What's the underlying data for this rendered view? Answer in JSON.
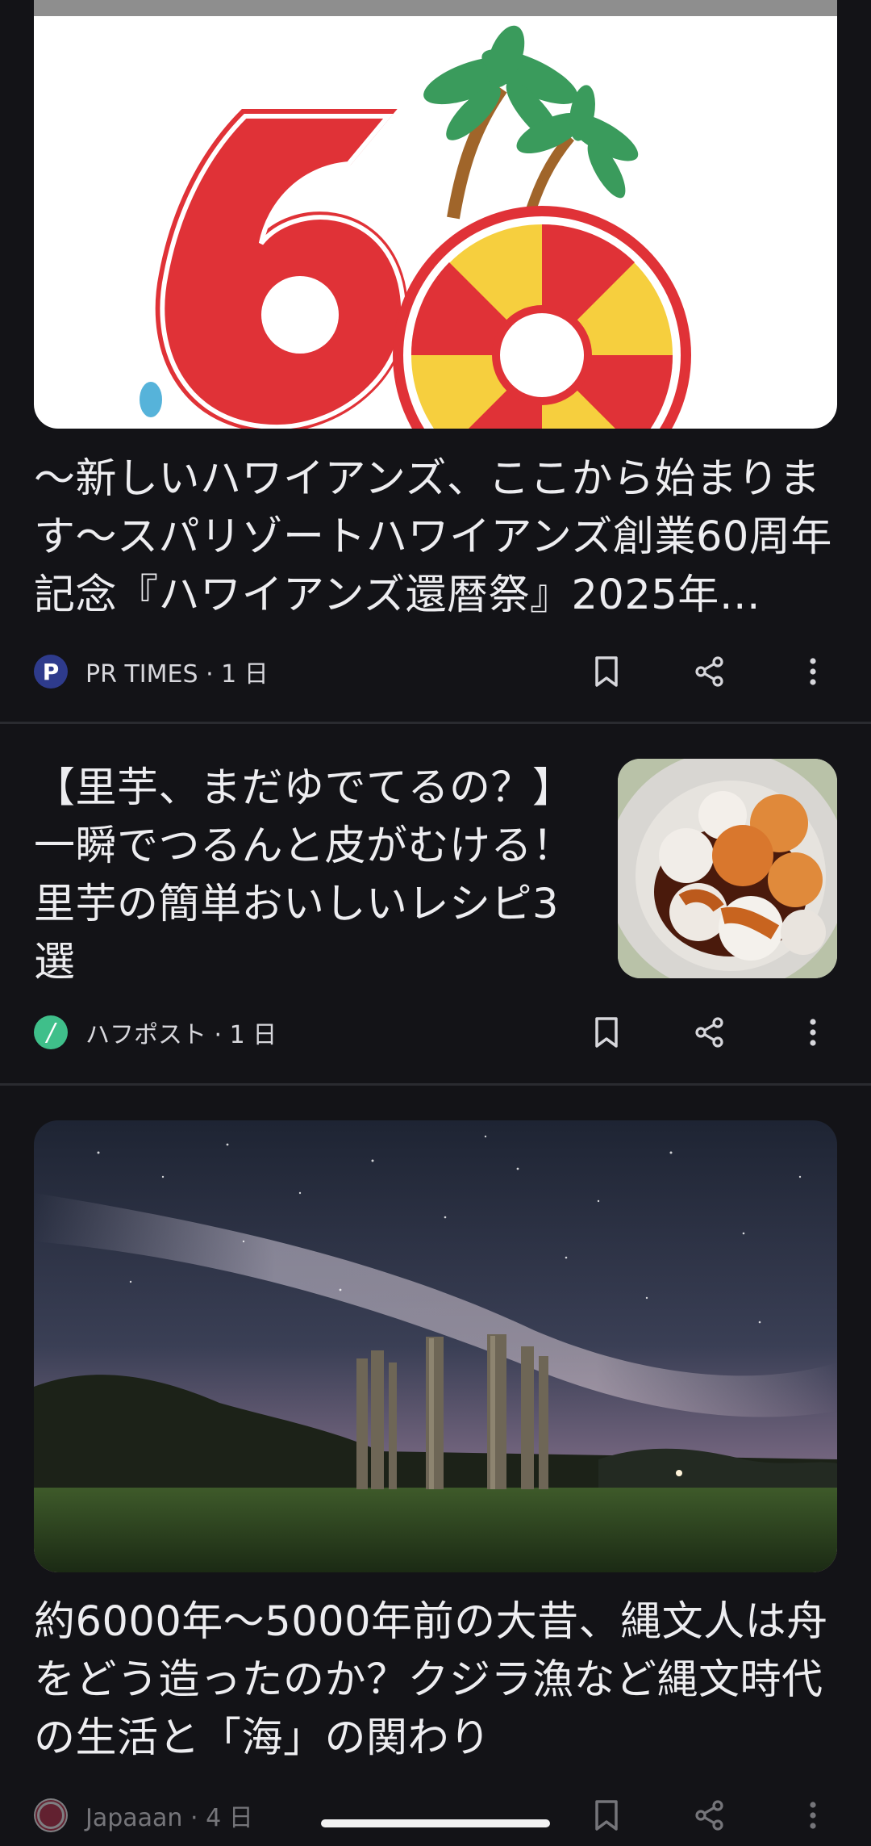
{
  "feed": {
    "articles": [
      {
        "headline": "〜新しいハワイアンズ、ここから始まります〜スパリゾートハワイアンズ創業60周年記念『ハワイアンズ還暦祭』2025年…",
        "source": "PR TIMES",
        "age": "1 日",
        "logo_letter": "P",
        "logo_color": "#2E3B8C",
        "image": "hawaiians-60th-anniversary-logo"
      },
      {
        "headline": "【里芋、まだゆでてるの？】一瞬でつるんと皮がむける！里芋の簡単おいしいレシピ3選",
        "source": "ハフポスト",
        "age": "1 日",
        "logo_letter": "/",
        "logo_color": "#3FBF8A",
        "image": "taro-dumplings-in-sauce"
      },
      {
        "headline": "約6000年〜5000年前の大昔、縄文人は舟をどう造ったのか？クジラ漁など縄文時代の生活と「海」の関わり",
        "source": "Japaaan",
        "age": "4 日",
        "logo_color": "#B0304A",
        "image": "milky-way-over-wooden-pillars"
      }
    ],
    "separator": "·"
  },
  "icons": {
    "bookmark": "bookmark-icon",
    "share": "share-icon",
    "more": "more-vert-icon"
  },
  "colors": {
    "background": "#131317",
    "divider": "#2A2B30",
    "text": "#EDEDF0"
  }
}
